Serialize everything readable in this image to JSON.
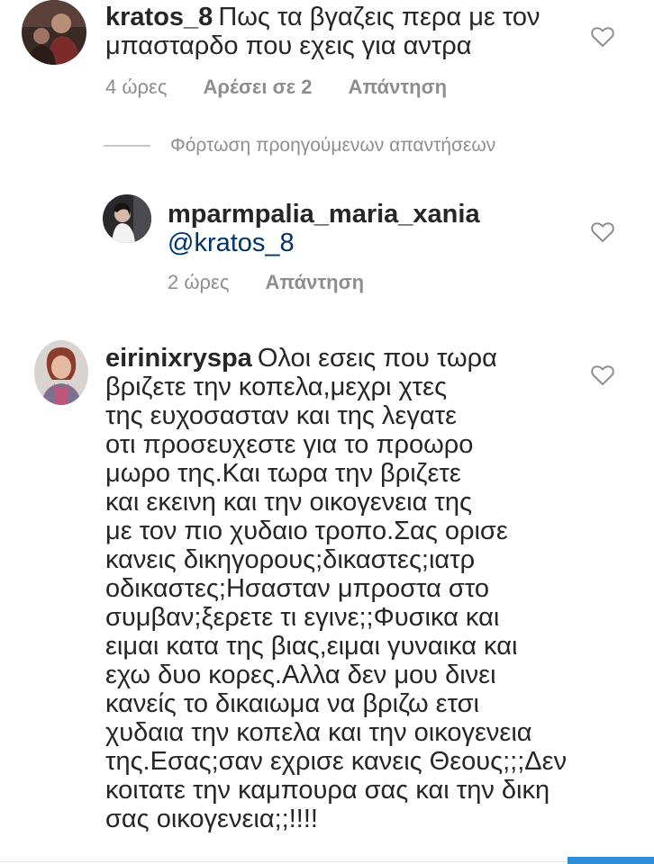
{
  "comments": [
    {
      "username": "kratos_8",
      "text_line1": "Πως τα βγαζεις περα με τον",
      "text_line2": "μπασταρδο που εχεις για αντρα",
      "time": "4 ώρες",
      "likes": "Αρέσει σε 2",
      "reply": "Απάντηση"
    }
  ],
  "load_previous_replies": "Φόρτωση προηγούμενων απαντήσεων",
  "reply_comment": {
    "username": "mparmpalia_maria_xania",
    "mention": "@kratos_8",
    "time": "2 ώρες",
    "reply": "Απάντηση"
  },
  "long_comment": {
    "username": "eirinixryspa",
    "first_line": "Ολοι εσεις που τωρα",
    "lines": [
      "βριζετε την κοπελα,μεχρι χτες",
      "της ευχοσασταν και της λεγατε",
      "οτι προσευχεστε για το προωρο",
      "μωρο της.Και τωρα την βριζετε",
      "και εκεινη και την οικογενεια της",
      "με τον πιο χυδαιο τροπο.Σας ορισε",
      "κανεις δικηγορους;δικαστες;ιατρ",
      "οδικαστες;Ησασταν μπροστα στο",
      "συμβαν;ξερετε τι εγινε;;Φυσικα και",
      "ειμαι κατα της βιας,ειμαι γυναικα και",
      "εχω δυο κορες.Αλλα δεν μου δινει",
      "κανείς το δικαιωμα να βριζω ετσι",
      "χυδαια την κοπελα και την οικογενεια",
      "της.Εσας;σαν εχρισε κανεις Θεους;;;Δεν",
      "κοιτατε την καμπουρα σας και την δικη",
      "σας οικογενεια;;!!!!"
    ]
  },
  "icons": {
    "like": "heart-outline-icon"
  },
  "colors": {
    "text": "#262626",
    "meta": "#8e8e8e",
    "mention": "#003569",
    "accent_bar": "#2f8ed8"
  }
}
